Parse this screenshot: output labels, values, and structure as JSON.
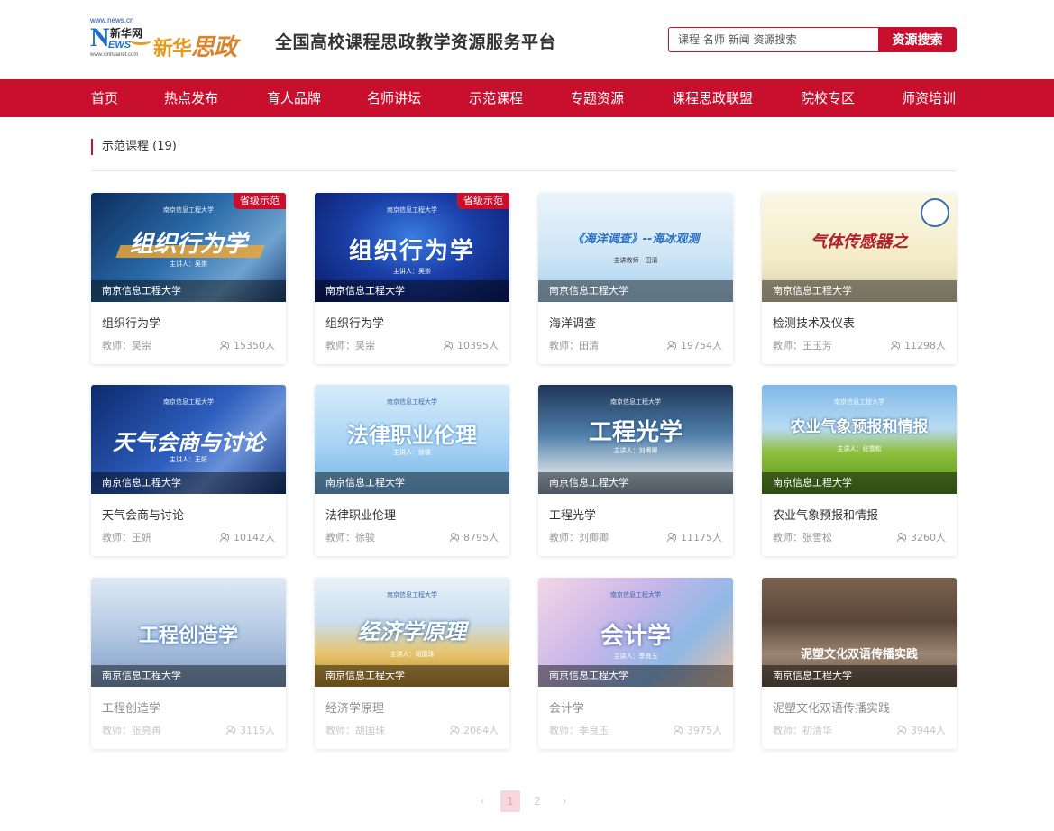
{
  "header": {
    "logo_url_top": "www.news.cn",
    "logo_n": "N",
    "logo_xhw": "新华网",
    "logo_ews": "EWS",
    "logo_url_bottom": "www.xinhuanet.com",
    "logo_xinhua": "新华",
    "logo_sizheng": "思政",
    "site_title": "全国高校课程思政教学资源服务平台"
  },
  "search": {
    "placeholder": "课程 名师 新闻 资源搜索",
    "button": "资源搜索"
  },
  "nav": {
    "items": [
      "首页",
      "热点发布",
      "育人品牌",
      "名师讲坛",
      "示范课程",
      "专题资源",
      "课程思政联盟",
      "院校专区",
      "师资培训"
    ]
  },
  "section": {
    "title": "示范课程 (19)"
  },
  "courses": [
    {
      "name": "组织行为学",
      "teacher": "教师：吴崇",
      "students": "15350人",
      "university": "南京信息工程大学",
      "badge": "省级示范",
      "thumb_title": "组织行为学",
      "speaker": "主讲人：吴崇"
    },
    {
      "name": "组织行为学",
      "teacher": "教师：吴崇",
      "students": "10395人",
      "university": "南京信息工程大学",
      "badge": "省级示范",
      "thumb_title": "组织行为学",
      "speaker": "主讲人：吴崇"
    },
    {
      "name": "海洋调查",
      "teacher": "教师：田清",
      "students": "19754人",
      "university": "南京信息工程大学",
      "thumb_title": "《海洋调查》--海冰观测",
      "speaker": "主讲教师　田清"
    },
    {
      "name": "检测技术及仪表",
      "teacher": "教师：王玉芳",
      "students": "11298人",
      "university": "南京信息工程大学",
      "thumb_title": "气体传感器之"
    },
    {
      "name": "天气会商与讨论",
      "teacher": "教师：王妍",
      "students": "10142人",
      "university": "南京信息工程大学",
      "thumb_title": "天气会商与讨论",
      "speaker": "主讲人：王妍"
    },
    {
      "name": "法律职业伦理",
      "teacher": "教师：徐骏",
      "students": "8795人",
      "university": "南京信息工程大学",
      "thumb_title": "法律职业伦理",
      "speaker": "主讲人：徐骏"
    },
    {
      "name": "工程光学",
      "teacher": "教师：刘卿卿",
      "students": "11175人",
      "university": "南京信息工程大学",
      "thumb_title": "工程光学",
      "speaker": "主讲人：刘卿卿"
    },
    {
      "name": "农业气象预报和情报",
      "teacher": "教师：张雪松",
      "students": "3260人",
      "university": "南京信息工程大学",
      "thumb_title": "农业气象预报和情报",
      "speaker": "主讲人：张雪松"
    },
    {
      "name": "工程创造学",
      "teacher": "教师：张亮再",
      "students": "3115人",
      "university": "南京信息工程大学",
      "thumb_title": "工程创造学"
    },
    {
      "name": "经济学原理",
      "teacher": "教师：胡国珠",
      "students": "2064人",
      "university": "南京信息工程大学",
      "thumb_title": "经济学原理",
      "speaker": "主讲人：胡国珠"
    },
    {
      "name": "会计学",
      "teacher": "教师：季良玉",
      "students": "3975人",
      "university": "南京信息工程大学",
      "thumb_title": "会计学",
      "speaker": "主讲人：季良玉"
    },
    {
      "name": "泥塑文化双语传播实践",
      "teacher": "教师：初清华",
      "students": "3944人",
      "university": "南京信息工程大学",
      "thumb_title": "泥塑文化双语传播实践"
    }
  ],
  "pagination": {
    "prev": "‹",
    "pages": [
      "1",
      "2"
    ],
    "next": "›",
    "current": "1"
  },
  "colors": {
    "brand": "#c8102e"
  }
}
